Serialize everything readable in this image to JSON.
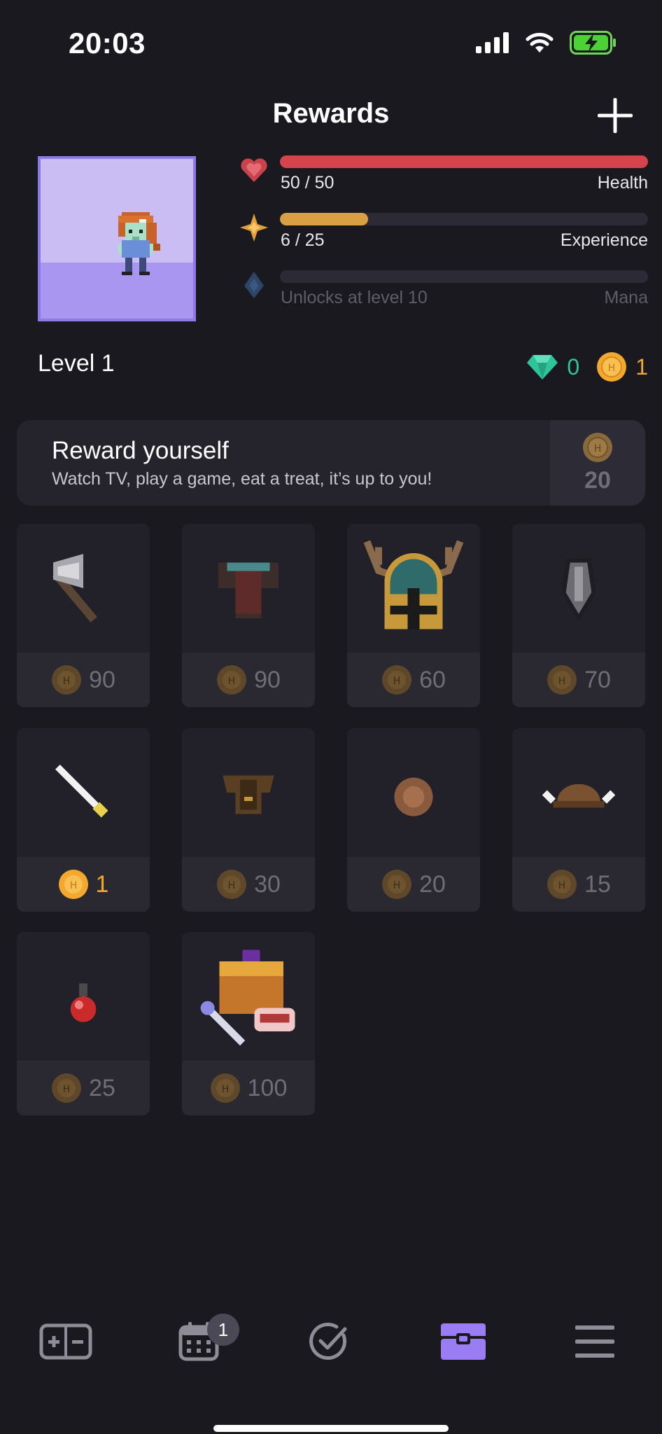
{
  "status_bar": {
    "time": "20:03"
  },
  "header": {
    "title": "Rewards"
  },
  "stats": {
    "health": {
      "value": "50 / 50",
      "label": "Health",
      "fraction": 1.0,
      "color": "#d5434d"
    },
    "experience": {
      "value": "6 / 25",
      "label": "Experience",
      "fraction": 0.24,
      "color": "#d9a043"
    },
    "mana": {
      "value": "Unlocks at level 10",
      "label": "Mana",
      "fraction": 0
    }
  },
  "level": "Level 1",
  "currency": {
    "gems": "0",
    "gold": "1"
  },
  "reward_card": {
    "title": "Reward yourself",
    "subtitle": "Watch TV, play a game, eat a treat, it’s up to you!",
    "price": "20"
  },
  "items": [
    {
      "icon": "battle-axe-icon",
      "price": "90"
    },
    {
      "icon": "armor-icon",
      "price": "90"
    },
    {
      "icon": "antler-helmet-icon",
      "price": "60"
    },
    {
      "icon": "shield-icon",
      "price": "70"
    },
    {
      "icon": "dagger-icon",
      "price": "1",
      "affordable": true
    },
    {
      "icon": "leather-armor-icon",
      "price": "30"
    },
    {
      "icon": "round-shield-icon",
      "price": "20"
    },
    {
      "icon": "horned-hat-icon",
      "price": "15"
    },
    {
      "icon": "health-potion-icon",
      "price": "25"
    },
    {
      "icon": "treasure-chest-icon",
      "price": "100"
    }
  ],
  "tab_bar": {
    "tabs": [
      "habits-tab",
      "dailies-tab",
      "todos-tab",
      "rewards-tab",
      "menu-tab"
    ],
    "dailies_badge": "1",
    "active_color": "#9a7cf3"
  }
}
